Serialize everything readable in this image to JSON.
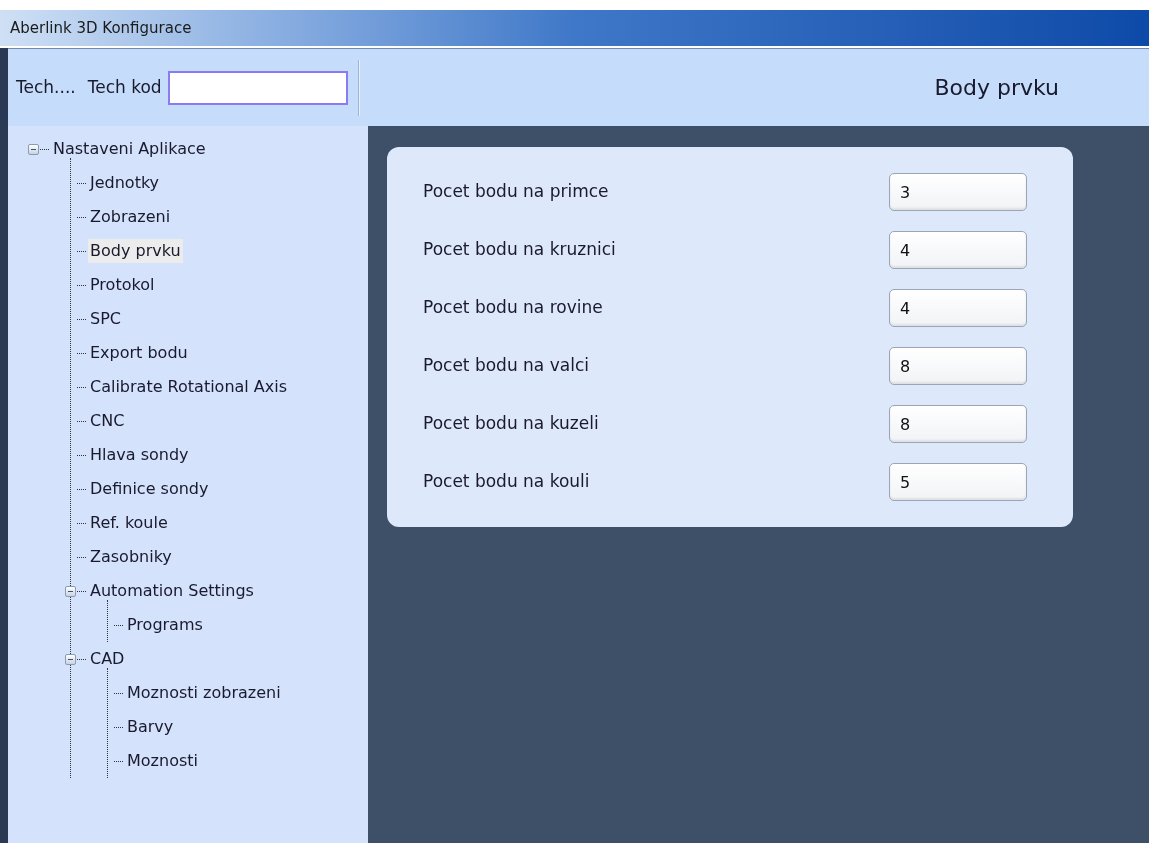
{
  "window": {
    "title": "Aberlink 3D Konfigurace"
  },
  "toolbar": {
    "tech_label": "Tech....",
    "code_label": "Tech kod"
  },
  "page_title": "Body prvku",
  "tree": [
    {
      "label": "Nastaveni Aplikace",
      "selected": false,
      "expanded": true,
      "children": [
        {
          "label": "Jednotky",
          "selected": false
        },
        {
          "label": "Zobrazeni",
          "selected": false
        },
        {
          "label": "Body prvku",
          "selected": true
        },
        {
          "label": "Protokol",
          "selected": false
        },
        {
          "label": "SPC",
          "selected": false
        },
        {
          "label": "Export bodu",
          "selected": false
        },
        {
          "label": "Calibrate Rotational Axis",
          "selected": false
        },
        {
          "label": "CNC",
          "selected": false
        },
        {
          "label": "Hlava sondy",
          "selected": false
        },
        {
          "label": "Definice sondy",
          "selected": false
        },
        {
          "label": "Ref. koule",
          "selected": false
        },
        {
          "label": "Zasobniky",
          "selected": false
        },
        {
          "label": "Automation Settings",
          "selected": false,
          "expanded": true,
          "children": [
            {
              "label": "Programs",
              "selected": false
            }
          ]
        },
        {
          "label": "CAD",
          "selected": false,
          "expanded": true,
          "children": [
            {
              "label": "Moznosti zobrazeni",
              "selected": false
            },
            {
              "label": "Barvy",
              "selected": false
            },
            {
              "label": "Moznosti",
              "selected": false
            }
          ]
        }
      ]
    }
  ],
  "fields": [
    {
      "label": "Pocet bodu na primce",
      "value": "3"
    },
    {
      "label": "Pocet bodu na kruznici",
      "value": "4"
    },
    {
      "label": "Pocet bodu na rovine",
      "value": "4"
    },
    {
      "label": "Pocet bodu na valci",
      "value": "8"
    },
    {
      "label": "Pocet bodu na kuzeli",
      "value": "8"
    },
    {
      "label": "Pocet bodu na kouli",
      "value": "5"
    }
  ]
}
